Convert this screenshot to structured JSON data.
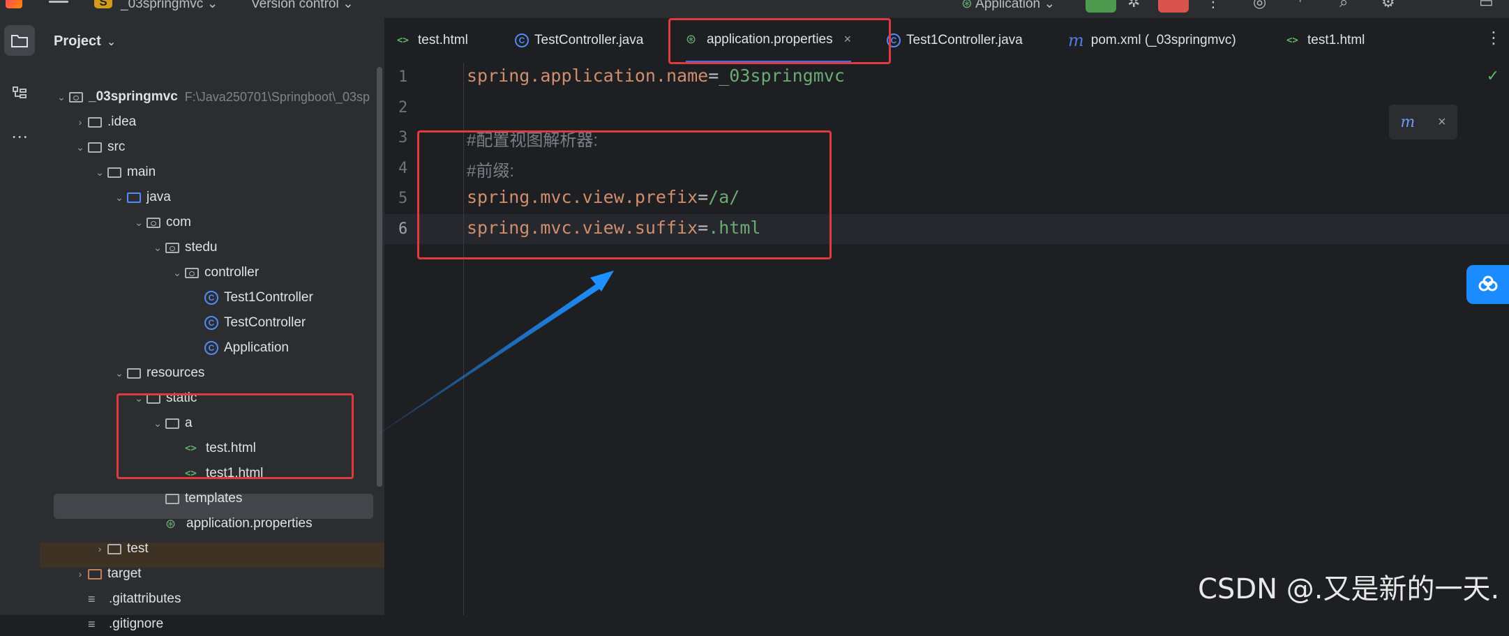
{
  "topbar": {
    "project_badge": "S",
    "project_name": "_03springmvc",
    "project_chevron": "⌄",
    "vcs": "Version control",
    "vcs_chevron": "⌄",
    "run_config": "Application",
    "run_chevron": "⌄"
  },
  "project_panel": {
    "title": "Project",
    "title_chevron": "⌄",
    "tree": [
      {
        "label": "_03springmvc",
        "hint": "F:\\Java250701\\Springboot\\_03sp",
        "kind": "module",
        "arrow": "⌄"
      },
      {
        "label": ".idea",
        "kind": "folder",
        "arrow": "›"
      },
      {
        "label": "src",
        "kind": "folder",
        "arrow": "⌄"
      },
      {
        "label": "main",
        "kind": "folder",
        "arrow": "⌄"
      },
      {
        "label": "java",
        "kind": "folder-blue",
        "arrow": "⌄"
      },
      {
        "label": "com",
        "kind": "package",
        "arrow": "⌄"
      },
      {
        "label": "stedu",
        "kind": "package",
        "arrow": "⌄"
      },
      {
        "label": "controller",
        "kind": "package",
        "arrow": "⌄"
      },
      {
        "label": "Test1Controller",
        "kind": "class",
        "arrow": ""
      },
      {
        "label": "TestController",
        "kind": "class",
        "arrow": ""
      },
      {
        "label": "Application",
        "kind": "spring-class",
        "arrow": ""
      },
      {
        "label": "resources",
        "kind": "resources",
        "arrow": "⌄"
      },
      {
        "label": "static",
        "kind": "folder",
        "arrow": "⌄"
      },
      {
        "label": "a",
        "kind": "folder",
        "arrow": "⌄"
      },
      {
        "label": "test.html",
        "kind": "html",
        "arrow": ""
      },
      {
        "label": "test1.html",
        "kind": "html",
        "arrow": ""
      },
      {
        "label": "templates",
        "kind": "folder",
        "arrow": ""
      },
      {
        "label": "application.properties",
        "kind": "properties",
        "arrow": ""
      },
      {
        "label": "test",
        "kind": "folder",
        "arrow": "›"
      },
      {
        "label": "target",
        "kind": "folder-orange",
        "arrow": "›"
      },
      {
        "label": ".gitattributes",
        "kind": "text",
        "arrow": ""
      },
      {
        "label": ".gitignore",
        "kind": "text",
        "arrow": ""
      }
    ]
  },
  "tabs": [
    {
      "label": "test.html",
      "icon": "html-icon",
      "active": false
    },
    {
      "label": "TestController.java",
      "icon": "class-icon",
      "active": false
    },
    {
      "label": "application.properties",
      "icon": "properties-icon",
      "active": true
    },
    {
      "label": "Test1Controller.java",
      "icon": "class-icon",
      "active": false
    },
    {
      "label": "pom.xml (_03springmvc)",
      "icon": "maven-icon",
      "active": false
    },
    {
      "label": "test1.html",
      "icon": "html-icon",
      "active": false
    }
  ],
  "tab_close": "×",
  "editor": {
    "line_numbers": [
      "1",
      "2",
      "3",
      "4",
      "5",
      "6"
    ],
    "lines": [
      {
        "key": "spring.application.name",
        "op": "=",
        "value": "_03springmvc"
      },
      {
        "comment": ""
      },
      {
        "comment": "#配置视图解析器:"
      },
      {
        "comment": "#前缀:"
      },
      {
        "key": "spring.mvc.view.prefix",
        "op": "=",
        "value": "/a/"
      },
      {
        "key": "spring.mvc.view.suffix",
        "op": "=",
        "value": ".html"
      }
    ],
    "current_line": 6,
    "status_check": "✓"
  },
  "maven_popup": {
    "icon_text": "m",
    "close": "×"
  },
  "watermark": "CSDN @.又是新的一天.",
  "colors": {
    "accent": "#3574f0",
    "annotation_red": "#e0393e",
    "arrow_blue": "#1e90ff",
    "run_green": "#4e9a4e",
    "stop_red": "#d9534f"
  }
}
